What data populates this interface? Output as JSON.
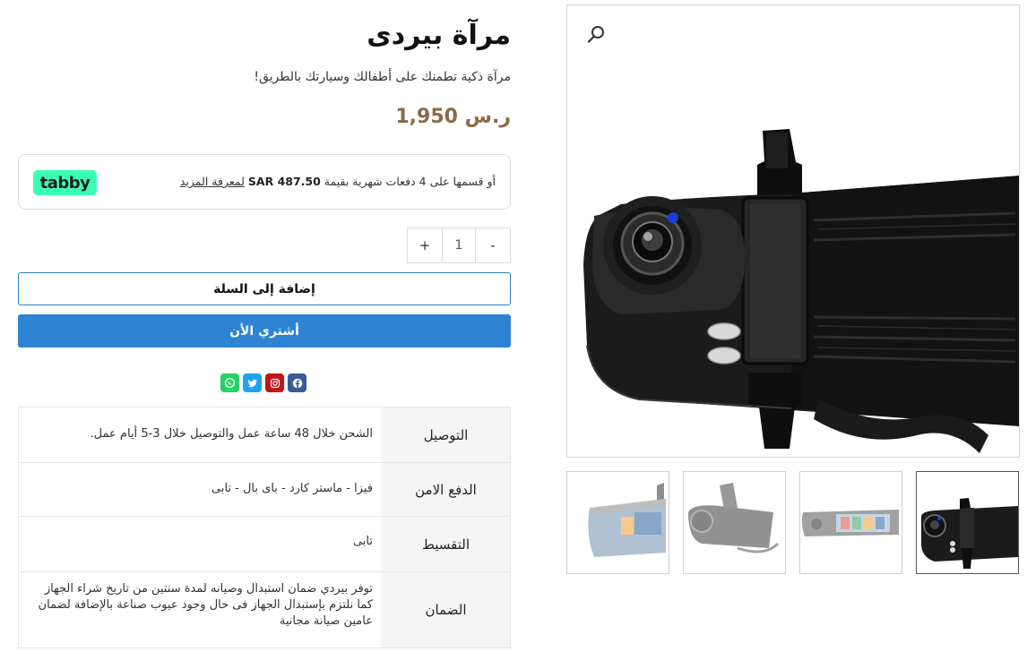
{
  "product": {
    "title": "مرآة بيردى",
    "subtitle": "مرآة ذكية تطمنك على أطفالك وسيارتك بالطريق!",
    "price": "ر.س 1,950"
  },
  "tabby": {
    "logo_text": "tabby",
    "prefix": "أو قسمها على 4 دفعات شهرية بقيمة ",
    "amount": "SAR 487.50",
    "learn_more": "لمعرفة المزيد"
  },
  "quantity": {
    "minus": "-",
    "value": "1",
    "plus": "+"
  },
  "buttons": {
    "add_to_cart": "إضافة إلى السلة",
    "buy_now": "أشتري الأن"
  },
  "share": [
    {
      "name": "facebook",
      "icon": "facebook-icon",
      "color": "#3b5998"
    },
    {
      "name": "instagram",
      "icon": "instagram-icon",
      "color": "#c0161c"
    },
    {
      "name": "twitter",
      "icon": "twitter-icon",
      "color": "#1da1f2"
    },
    {
      "name": "whatsapp",
      "icon": "whatsapp-icon",
      "color": "#25d366"
    }
  ],
  "specs": [
    {
      "key": "التوصيل",
      "value": "الشحن خلال 48 ساعة عمل والتوصيل خلال 3-5 أيام عمل."
    },
    {
      "key": "الدفع الامن",
      "value": "فيزا - ماستر كارد - باى بال - تابى"
    },
    {
      "key": "التقسيط",
      "value": "تابى"
    },
    {
      "key": "الضمان",
      "value": "توفر بيردي ضمان استبدال وصيانه لمدة سنتين من تاريخ شراء الجهاز كما نلتزم بإستبدال الجهاز فى حال وجود عيوب صناعة بالإضافة لضمان عامين صيانة مجانية"
    }
  ],
  "gallery": {
    "zoom_icon": "search-icon",
    "selected_index": 3,
    "thumbnails": 4
  },
  "colors": {
    "accent": "#2e84d2",
    "price": "#8b6a48",
    "tabby": "#3bffb6"
  }
}
